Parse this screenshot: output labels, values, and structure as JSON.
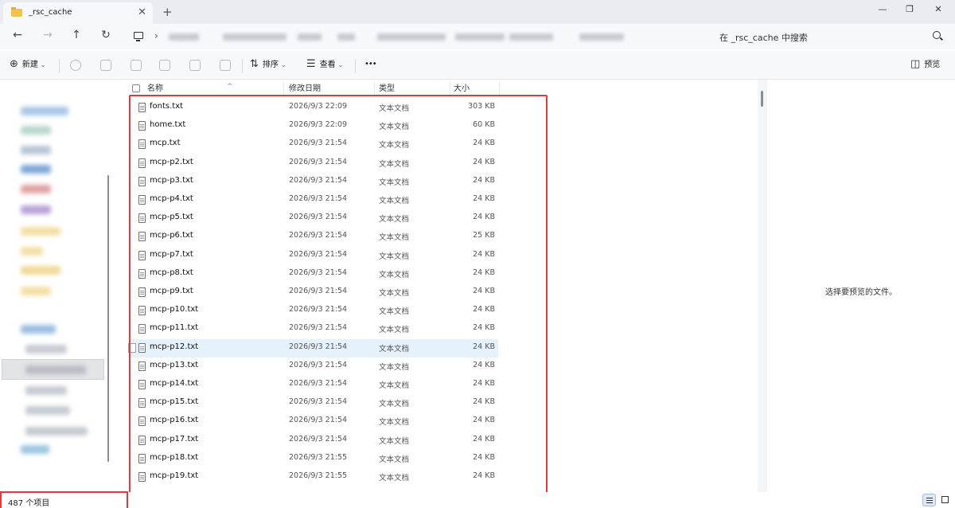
{
  "window": {
    "tab_title": "_rsc_cache",
    "tab_close": "✕",
    "new_tab": "+",
    "minimize": "—",
    "restore": "❐",
    "close": "✕"
  },
  "nav": {
    "back": "←",
    "forward": "→",
    "up": "↑",
    "refresh": "↻",
    "breadcrumb_chevron": "›"
  },
  "search": {
    "placeholder": "在 _rsc_cache 中搜索"
  },
  "toolbar": {
    "new_label": "新建",
    "sort_label": "排序",
    "view_label": "查看",
    "more_label": "•••",
    "preview_label": "预览",
    "icons": [
      "cut-icon",
      "copy-icon",
      "paste-icon",
      "rename-icon",
      "share-icon",
      "delete-icon"
    ]
  },
  "columns": {
    "name": "名称",
    "date": "修改日期",
    "type": "类型",
    "size": "大小"
  },
  "files": [
    {
      "name": "fonts.txt",
      "date": "2026/9/3 22:09",
      "type": "文本文档",
      "size": "303 KB"
    },
    {
      "name": "home.txt",
      "date": "2026/9/3 22:09",
      "type": "文本文档",
      "size": "60 KB"
    },
    {
      "name": "mcp.txt",
      "date": "2026/9/3 21:54",
      "type": "文本文档",
      "size": "24 KB"
    },
    {
      "name": "mcp-p2.txt",
      "date": "2026/9/3 21:54",
      "type": "文本文档",
      "size": "24 KB"
    },
    {
      "name": "mcp-p3.txt",
      "date": "2026/9/3 21:54",
      "type": "文本文档",
      "size": "24 KB"
    },
    {
      "name": "mcp-p4.txt",
      "date": "2026/9/3 21:54",
      "type": "文本文档",
      "size": "24 KB"
    },
    {
      "name": "mcp-p5.txt",
      "date": "2026/9/3 21:54",
      "type": "文本文档",
      "size": "24 KB"
    },
    {
      "name": "mcp-p6.txt",
      "date": "2026/9/3 21:54",
      "type": "文本文档",
      "size": "25 KB"
    },
    {
      "name": "mcp-p7.txt",
      "date": "2026/9/3 21:54",
      "type": "文本文档",
      "size": "24 KB"
    },
    {
      "name": "mcp-p8.txt",
      "date": "2026/9/3 21:54",
      "type": "文本文档",
      "size": "24 KB"
    },
    {
      "name": "mcp-p9.txt",
      "date": "2026/9/3 21:54",
      "type": "文本文档",
      "size": "24 KB"
    },
    {
      "name": "mcp-p10.txt",
      "date": "2026/9/3 21:54",
      "type": "文本文档",
      "size": "24 KB"
    },
    {
      "name": "mcp-p11.txt",
      "date": "2026/9/3 21:54",
      "type": "文本文档",
      "size": "24 KB"
    },
    {
      "name": "mcp-p12.txt",
      "date": "2026/9/3 21:54",
      "type": "文本文档",
      "size": "24 KB"
    },
    {
      "name": "mcp-p13.txt",
      "date": "2026/9/3 21:54",
      "type": "文本文档",
      "size": "24 KB"
    },
    {
      "name": "mcp-p14.txt",
      "date": "2026/9/3 21:54",
      "type": "文本文档",
      "size": "24 KB"
    },
    {
      "name": "mcp-p15.txt",
      "date": "2026/9/3 21:54",
      "type": "文本文档",
      "size": "24 KB"
    },
    {
      "name": "mcp-p16.txt",
      "date": "2026/9/3 21:54",
      "type": "文本文档",
      "size": "24 KB"
    },
    {
      "name": "mcp-p17.txt",
      "date": "2026/9/3 21:54",
      "type": "文本文档",
      "size": "24 KB"
    },
    {
      "name": "mcp-p18.txt",
      "date": "2026/9/3 21:55",
      "type": "文本文档",
      "size": "24 KB"
    },
    {
      "name": "mcp-p19.txt",
      "date": "2026/9/3 21:55",
      "type": "文本文档",
      "size": "24 KB"
    }
  ],
  "hovered_file": "mcp-p12.txt",
  "preview": {
    "empty_text": "选择要预览的文件。"
  },
  "status": {
    "item_count": "487 个项目"
  },
  "colors": {
    "highlight_border": "#e5383b",
    "hover_row": "#e5f1fb",
    "folder": "#f2c14e"
  }
}
